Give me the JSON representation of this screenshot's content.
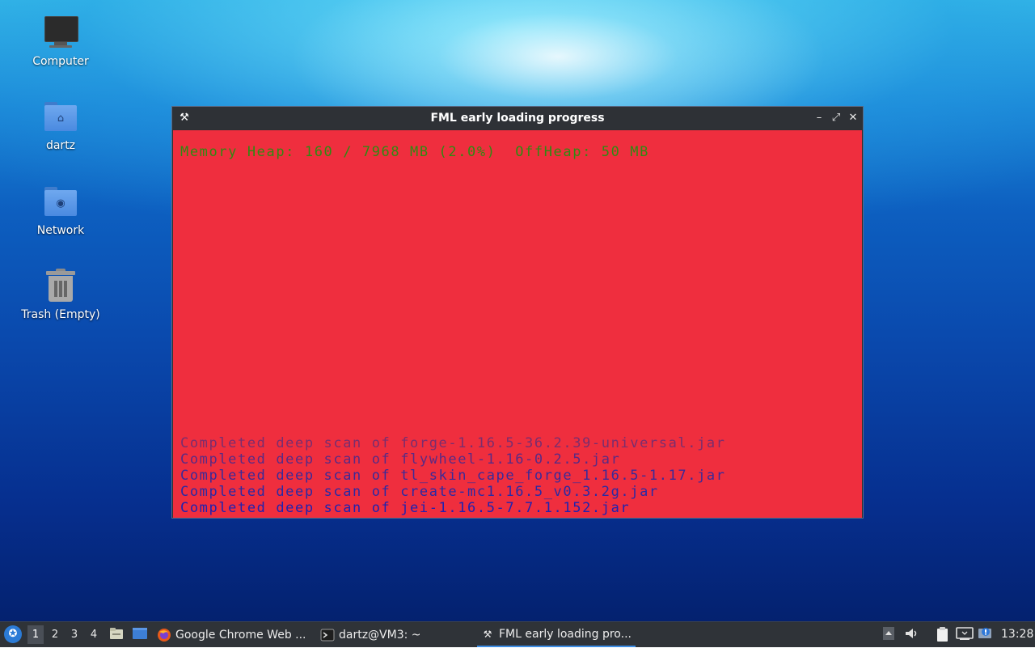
{
  "desktop": {
    "icons": [
      {
        "label": "Computer"
      },
      {
        "label": "dartz"
      },
      {
        "label": "Network"
      },
      {
        "label": "Trash (Empty)"
      }
    ]
  },
  "window": {
    "title": "FML early loading progress",
    "app_icon": "forge-anvil-icon",
    "memory_line": "Memory Heap: 160 / 7968 MB (2.0%)  OffHeap: 50 MB",
    "scan_lines": [
      {
        "text": "Completed deep scan of forge-1.16.5-36.2.39-universal.jar",
        "color": "#7a2d6e"
      },
      {
        "text": "Completed deep scan of flywheel-1.16-0.2.5.jar",
        "color": "#5a2a84"
      },
      {
        "text": "Completed deep scan of tl_skin_cape_forge_1.16.5-1.17.jar",
        "color": "#3b2a98"
      },
      {
        "text": "Completed deep scan of create-mc1.16.5_v0.3.2g.jar",
        "color": "#2a2aa4"
      },
      {
        "text": "Completed deep scan of jei-1.16.5-7.7.1.152.jar",
        "color": "#1f22b0"
      }
    ],
    "colors": {
      "background": "#ef2e3e",
      "memory_text": "#2f8a12"
    }
  },
  "taskbar": {
    "workspaces": [
      "1",
      "2",
      "3",
      "4"
    ],
    "active_workspace": "1",
    "tasks": [
      {
        "label": "Google Chrome Web ...",
        "icon": "firefox-icon"
      },
      {
        "label": "dartz@VM3: ~",
        "icon": "terminal-icon"
      },
      {
        "label": "FML early loading pro...",
        "icon": "forge-anvil-icon"
      }
    ],
    "clock": "13:28"
  }
}
